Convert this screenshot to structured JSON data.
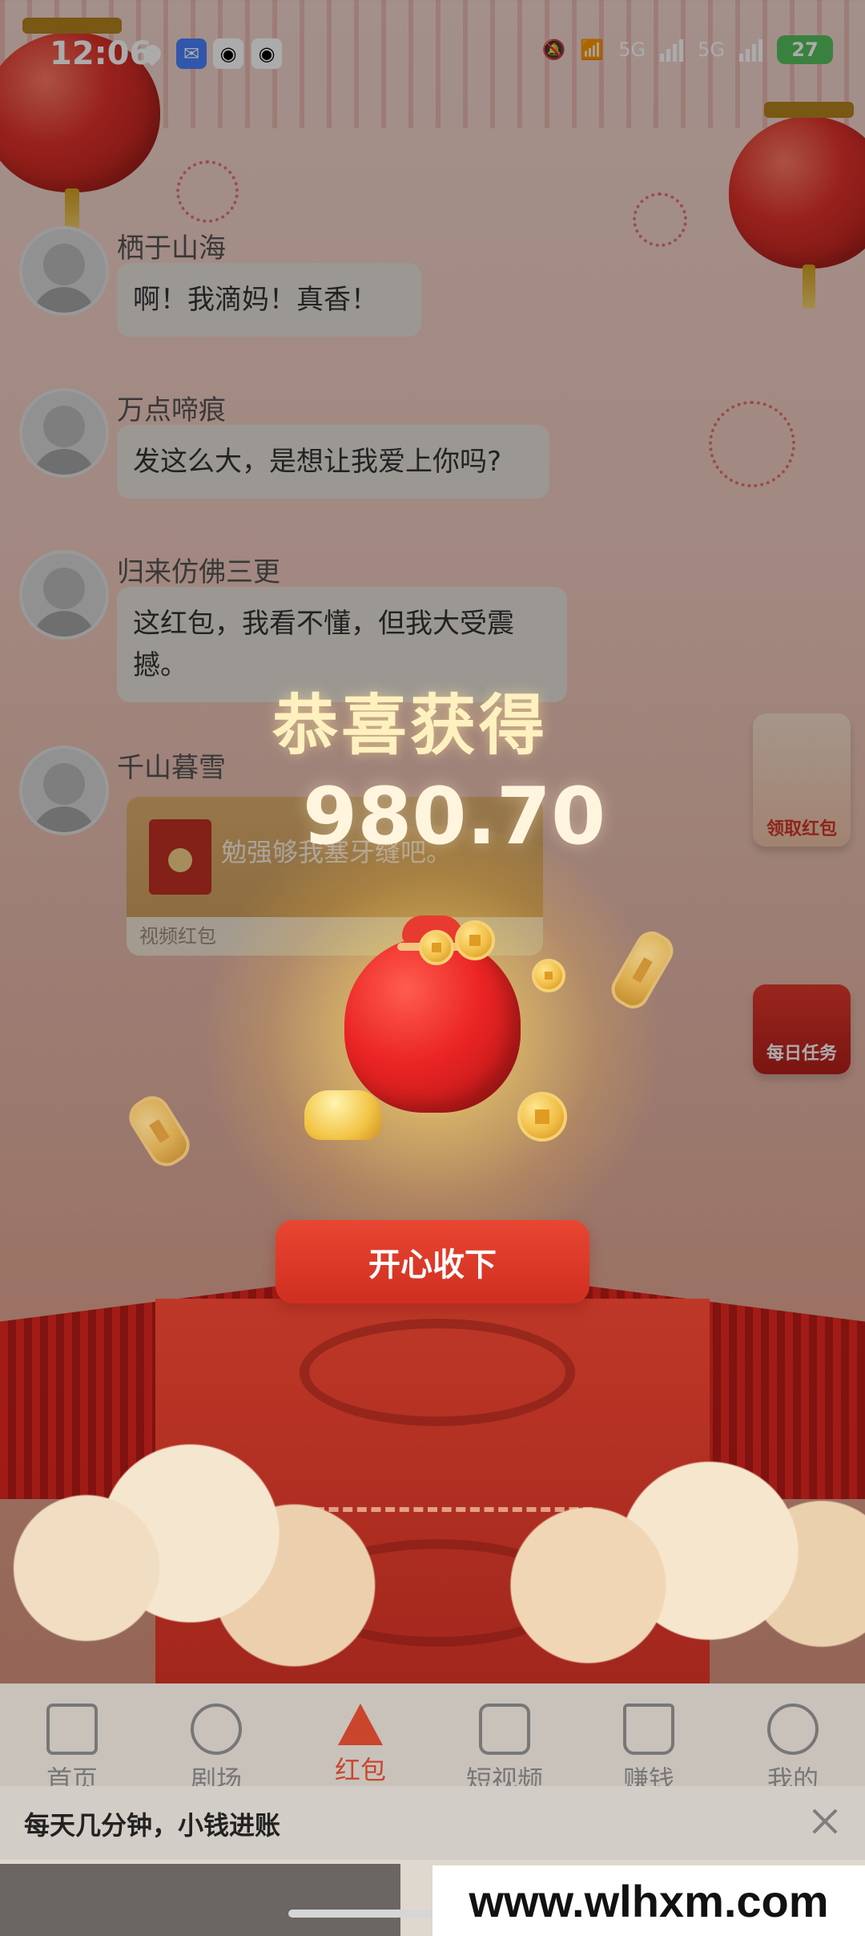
{
  "status_bar": {
    "time": "12:06",
    "network_1": "5G",
    "network_2": "5G",
    "battery": "27"
  },
  "chat": [
    {
      "username": "栖于山海",
      "message": "啊！我滴妈！真香！"
    },
    {
      "username": "万点啼痕",
      "message": "发这么大，是想让我爱上你吗?"
    },
    {
      "username": "归来仿佛三更",
      "message": "这红包，我看不懂，但我大受震撼。"
    },
    {
      "username": "千山暮雪",
      "message": "勉强够我塞牙缝吧。",
      "card_footer": "视频红包"
    }
  ],
  "floating_buttons": {
    "grab_red_packet": "领取红包",
    "daily_tasks": "每日任务"
  },
  "reward": {
    "title": "恭喜获得",
    "amount": "980.70",
    "button": "开心收下"
  },
  "bottom_nav": [
    {
      "label": "首页",
      "icon": "home-icon"
    },
    {
      "label": "剧场",
      "icon": "planet-icon"
    },
    {
      "label": "红包",
      "icon": "red-packet-icon"
    },
    {
      "label": "短视频",
      "icon": "video-icon"
    },
    {
      "label": "赚钱",
      "icon": "cart-icon"
    },
    {
      "label": "我的",
      "icon": "user-icon"
    }
  ],
  "tip_bar": {
    "text": "每天几分钟，小钱进账"
  },
  "watermark": "www.wlhxm.com",
  "colors": {
    "accent": "#c9462d",
    "gold": "#fff1bf",
    "button": "#d93b2a"
  }
}
